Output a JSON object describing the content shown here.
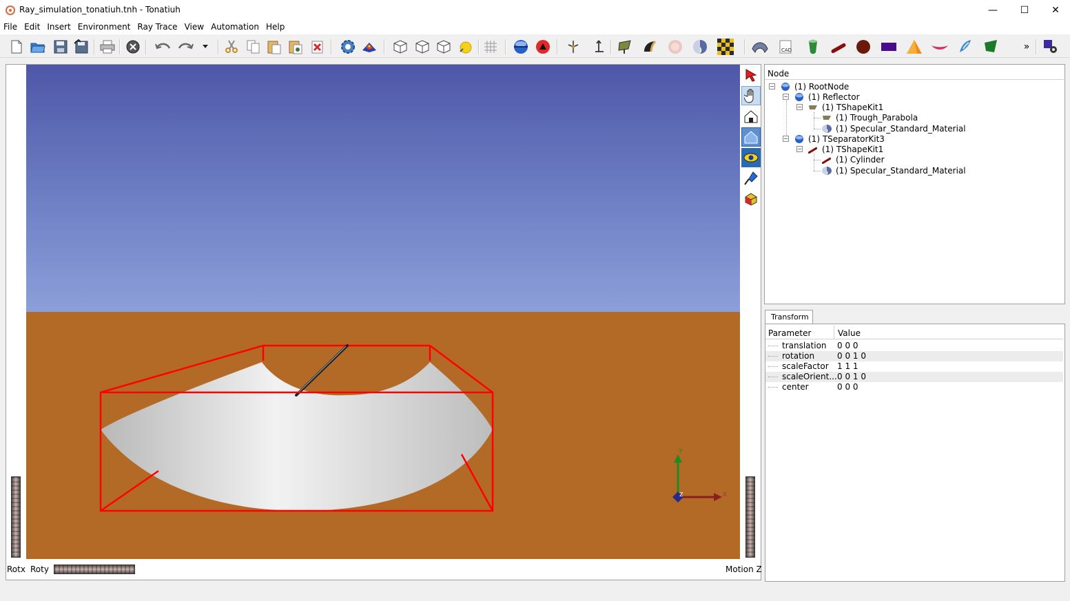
{
  "window": {
    "title": "Ray_simulation_tonatiuh.tnh - Tonatiuh",
    "minimize": "—",
    "maximize": "☐",
    "close": "✕"
  },
  "menu": [
    "File",
    "Edit",
    "Insert",
    "Environment",
    "Ray Trace",
    "View",
    "Automation",
    "Help"
  ],
  "toolbar": {
    "overflow": "»",
    "icons": [
      "new-file-icon",
      "open-file-icon",
      "save-icon",
      "save-as-icon",
      "print-icon",
      "close-scene-icon",
      "undo-icon",
      "redo-icon",
      "undo-dropdown-icon",
      "cut-icon",
      "copy-icon",
      "paste-icon",
      "paste-link-icon",
      "delete-icon",
      "ray-trace-settings-icon",
      "run-flux-icon",
      "view-xy-icon",
      "view-yz-icon",
      "view-xz-icon",
      "view-sun-icon",
      "grid-icon",
      "surface-node-icon",
      "separator-node-icon",
      "transform-icon",
      "orient-icon",
      "heliostat-icon",
      "trough-icon",
      "sun-icon",
      "material-icon",
      "checker-icon",
      "shape-plugin-icon",
      "cad-icon",
      "cone-icon",
      "cylinder-icon",
      "sphere-icon",
      "flat-rectangle-icon",
      "triangle-icon",
      "parabolic-dish-icon",
      "hyperbola-icon",
      "green-shape-icon",
      "settings-icon"
    ]
  },
  "viewer": {
    "rotx_label": "Rotx",
    "roty_label": "Roty",
    "motionz_label": "Motion Z",
    "axis_x": "X",
    "axis_y": "Y",
    "axis_z": "Z",
    "sky_color": "#6b7cc2",
    "ground_color": "#b46a27",
    "bbox_color": "#ff0000"
  },
  "side_tools": [
    "select-arrow-icon",
    "pan-hand-icon",
    "home-view-icon",
    "set-home-icon",
    "view-all-icon",
    "seek-icon",
    "toggle-projection-icon"
  ],
  "tree": {
    "header": "Node",
    "nodes": [
      {
        "label": "(1) RootNode",
        "icon": "sphere-node-icon"
      },
      {
        "label": "(1) Reflector",
        "icon": "sphere-node-icon"
      },
      {
        "label": "(1) TShapeKit1",
        "icon": "trough-shape-icon"
      },
      {
        "label": "(1) Trough_Parabola",
        "icon": "trough-shape-icon"
      },
      {
        "label": "(1) Specular_Standard_Material",
        "icon": "material-icon"
      },
      {
        "label": "(1) TSeparatorKit3",
        "icon": "sphere-node-icon"
      },
      {
        "label": "(1) TShapeKit1",
        "icon": "cylinder-shape-icon"
      },
      {
        "label": "(1) Cylinder",
        "icon": "cylinder-shape-icon"
      },
      {
        "label": "(1) Specular_Standard_Material",
        "icon": "material-icon"
      }
    ]
  },
  "properties": {
    "tab": "Transform",
    "col_parameter": "Parameter",
    "col_value": "Value",
    "rows": [
      {
        "parameter": "translation",
        "value": "0 0 0"
      },
      {
        "parameter": "rotation",
        "value": "0 0 1 0"
      },
      {
        "parameter": "scaleFactor",
        "value": "1 1 1"
      },
      {
        "parameter": "scaleOrient...",
        "value": "0 0 1 0"
      },
      {
        "parameter": "center",
        "value": "0 0 0"
      }
    ]
  }
}
